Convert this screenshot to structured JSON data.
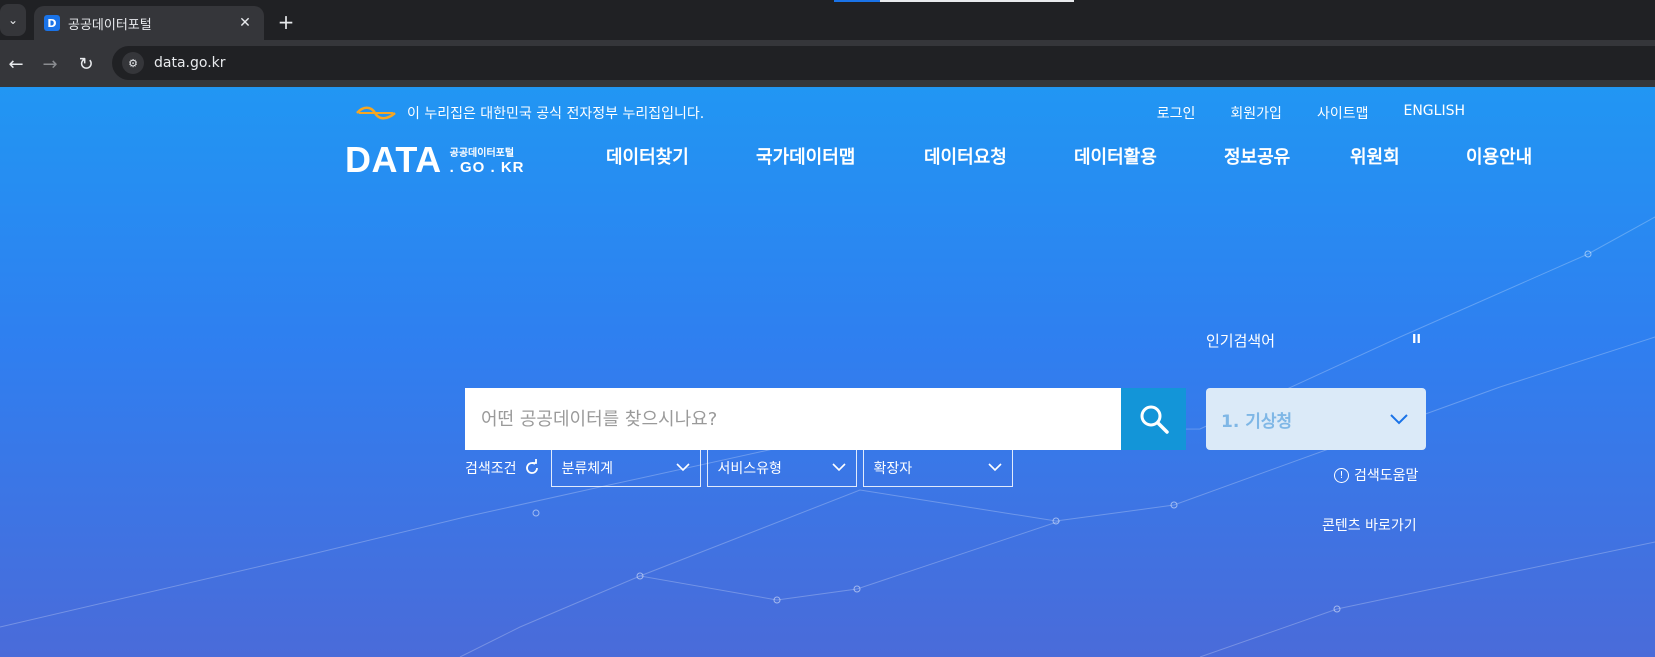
{
  "browser": {
    "tab_title": "공공데이터포털",
    "favicon_letter": "D",
    "url": "data.go.kr"
  },
  "header": {
    "gov_banner": "이 누리집은 대한민국 공식 전자정부 누리집입니다.",
    "util_links": [
      "로그인",
      "회원가입",
      "사이트맵",
      "ENGLISH"
    ],
    "brand_big": "DATA",
    "brand_small_top": "공공데이터포털",
    "brand_small_bottom": ". GO . KR",
    "gnb": [
      "데이터찾기",
      "국가데이터맵",
      "데이터요청",
      "데이터활용",
      "정보공유",
      "위원회",
      "이용안내"
    ]
  },
  "search": {
    "placeholder": "어떤 공공데이터를 찾으시나요?",
    "popular_label": "인기검색어",
    "popular_current": "1. 기상청",
    "filter_label": "검색조건",
    "filters": [
      "분류체계",
      "서비스유형",
      "확장자"
    ],
    "help_link": "검색도움말",
    "skip_link": "콘텐츠 바로가기"
  },
  "colors": {
    "brand_blue": "#2196f3",
    "search_button": "#1395d8",
    "popular_box": "#dbeaf8"
  }
}
